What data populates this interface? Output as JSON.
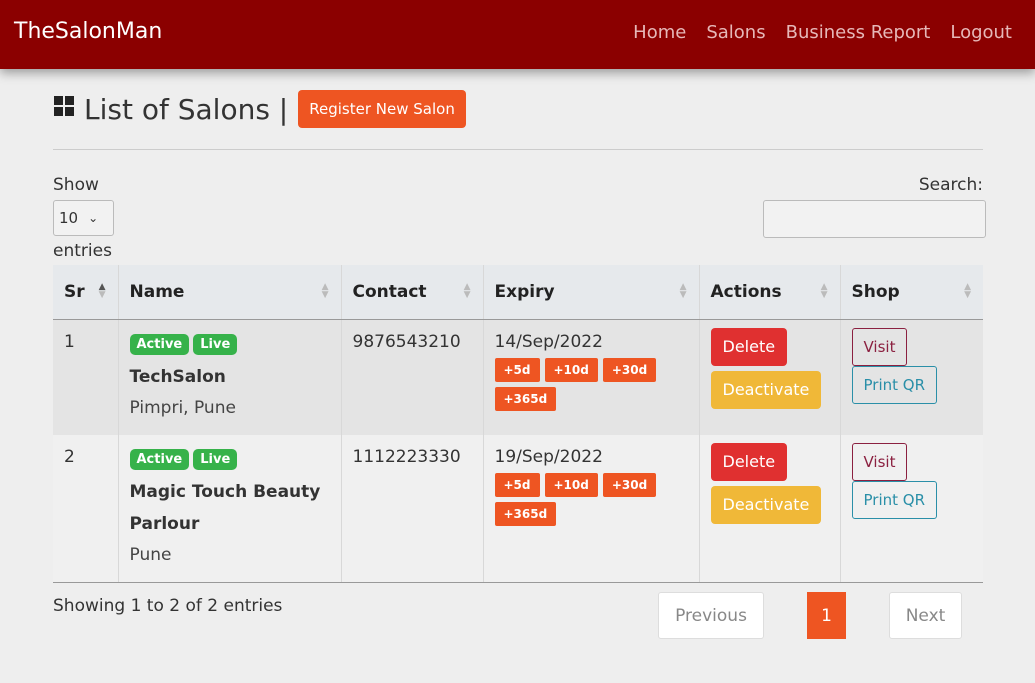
{
  "navbar": {
    "brand": "TheSalonMan",
    "links": [
      "Home",
      "Salons",
      "Business Report",
      "Logout"
    ]
  },
  "page": {
    "title": "List of Salons |",
    "register_label": "Register New Salon"
  },
  "table_controls": {
    "show_label": "Show",
    "entries_value": "10",
    "entries_label": "entries",
    "search_label": "Search:",
    "search_value": ""
  },
  "table": {
    "columns": [
      "Sr",
      "Name",
      "Contact",
      "Expiry",
      "Actions",
      "Shop"
    ],
    "rows": [
      {
        "sr": "1",
        "badges": [
          "Active",
          "Live"
        ],
        "name": "TechSalon",
        "location": "Pimpri, Pune",
        "contact": "9876543210",
        "expiry": "14/Sep/2022",
        "extend": [
          "+5d",
          "+10d",
          "+30d",
          "+365d"
        ],
        "delete_label": "Delete",
        "deactivate_label": "Deactivate",
        "visit_label": "Visit",
        "print_label": "Print QR"
      },
      {
        "sr": "2",
        "badges": [
          "Active",
          "Live"
        ],
        "name": "Magic Touch Beauty Parlour",
        "location": "Pune",
        "contact": "1112223330",
        "expiry": "19/Sep/2022",
        "extend": [
          "+5d",
          "+10d",
          "+30d",
          "+365d"
        ],
        "delete_label": "Delete",
        "deactivate_label": "Deactivate",
        "visit_label": "Visit",
        "print_label": "Print QR"
      }
    ]
  },
  "footer": {
    "info": "Showing 1 to 2 of 2 entries",
    "previous": "Previous",
    "current_page": "1",
    "next": "Next"
  },
  "colors": {
    "navbar": "#8b0000",
    "accent": "#ee5522",
    "badge_green": "#36b24a",
    "delete_red": "#e03030",
    "deactivate_yellow": "#f0b838"
  }
}
